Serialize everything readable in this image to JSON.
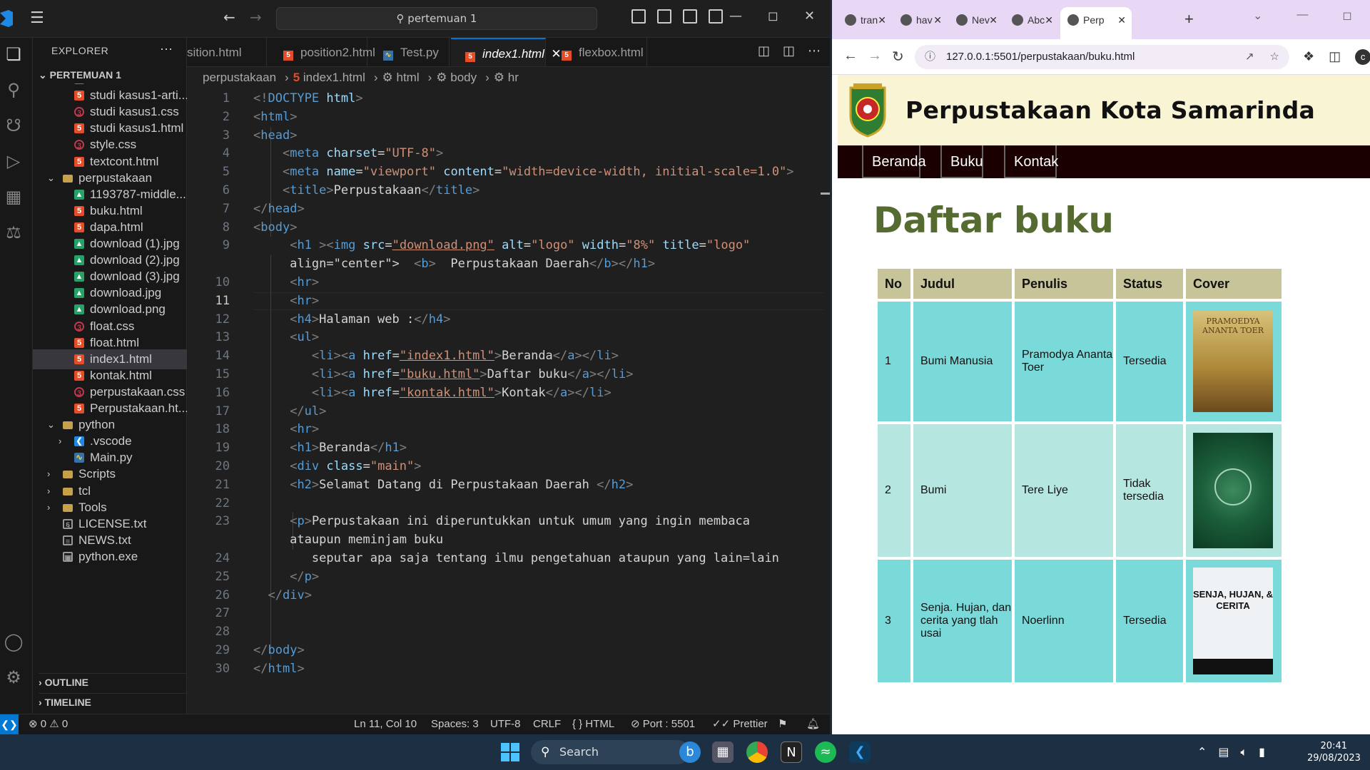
{
  "vscode": {
    "search_text": "pertemuan 1",
    "explorer_title": "EXPLORER",
    "workspace_root": "PERTEMUAN 1",
    "tree": [
      {
        "label": "studi kasus1-arti...",
        "icon": "html-file-icon",
        "depth": 2
      },
      {
        "label": "studi kasus1-arti...",
        "icon": "html-file-icon",
        "depth": 2
      },
      {
        "label": "studi kasus1.css",
        "icon": "css-file-icon",
        "depth": 2
      },
      {
        "label": "studi kasus1.html",
        "icon": "html-file-icon",
        "depth": 2
      },
      {
        "label": "style.css",
        "icon": "css-file-icon",
        "depth": 2
      },
      {
        "label": "textcont.html",
        "icon": "html-file-icon",
        "depth": 2
      },
      {
        "label": "perpustakaan",
        "icon": "folder-icon",
        "depth": 1,
        "expanded": true
      },
      {
        "label": "1193787-middle...",
        "icon": "image-file-icon",
        "depth": 2
      },
      {
        "label": "buku.html",
        "icon": "html-file-icon",
        "depth": 2
      },
      {
        "label": "dapa.html",
        "icon": "html-file-icon",
        "depth": 2
      },
      {
        "label": "download (1).jpg",
        "icon": "image-file-icon",
        "depth": 2
      },
      {
        "label": "download (2).jpg",
        "icon": "image-file-icon",
        "depth": 2
      },
      {
        "label": "download (3).jpg",
        "icon": "image-file-icon",
        "depth": 2
      },
      {
        "label": "download.jpg",
        "icon": "image-file-icon",
        "depth": 2
      },
      {
        "label": "download.png",
        "icon": "image-file-icon",
        "depth": 2
      },
      {
        "label": "float.css",
        "icon": "css-file-icon",
        "depth": 2
      },
      {
        "label": "float.html",
        "icon": "html-file-icon",
        "depth": 2
      },
      {
        "label": "index1.html",
        "icon": "html-file-icon",
        "depth": 2,
        "selected": true
      },
      {
        "label": "kontak.html",
        "icon": "html-file-icon",
        "depth": 2
      },
      {
        "label": "perpustakaan.css",
        "icon": "css-file-icon",
        "depth": 2
      },
      {
        "label": "Perpustakaan.ht...",
        "icon": "html-file-icon",
        "depth": 2
      },
      {
        "label": "python",
        "icon": "folder-icon",
        "depth": 1,
        "expanded": true
      },
      {
        "label": ".vscode",
        "icon": "vscode-folder-icon",
        "depth": 2,
        "expanded": false
      },
      {
        "label": "Main.py",
        "icon": "python-file-icon",
        "depth": 2
      },
      {
        "label": "Scripts",
        "icon": "folder-icon",
        "depth": 1,
        "expanded": false
      },
      {
        "label": "tcl",
        "icon": "folder-icon",
        "depth": 1,
        "expanded": false
      },
      {
        "label": "Tools",
        "icon": "folder-icon",
        "depth": 1,
        "expanded": false
      },
      {
        "label": "LICENSE.txt",
        "icon": "license-file-icon",
        "depth": 1
      },
      {
        "label": "NEWS.txt",
        "icon": "text-file-icon",
        "depth": 1
      },
      {
        "label": "python.exe",
        "icon": "exe-file-icon",
        "depth": 1
      }
    ],
    "outline_label": "OUTLINE",
    "timeline_label": "TIMELINE",
    "tabs": [
      {
        "label": "sition.html",
        "icon": "html-file-icon",
        "active": false
      },
      {
        "label": "position2.html",
        "icon": "html-file-icon",
        "active": false
      },
      {
        "label": "Test.py",
        "icon": "python-file-icon",
        "active": false
      },
      {
        "label": "index1.html",
        "icon": "html-file-icon",
        "active": true
      },
      {
        "label": "flexbox.html",
        "icon": "html-file-icon",
        "active": false
      }
    ],
    "breadcrumb": [
      "perpustakaan",
      "index1.html",
      "html",
      "body",
      "hr"
    ],
    "current_line": 11,
    "line_numbers": [
      "1",
      "2",
      "3",
      "4",
      "5",
      "6",
      "7",
      "8",
      "9",
      "",
      "10",
      "11",
      "12",
      "13",
      "14",
      "15",
      "16",
      "17",
      "18",
      "19",
      "20",
      "21",
      "22",
      "23",
      "",
      "24",
      "25",
      "26",
      "27",
      "28",
      "29",
      "30"
    ],
    "code_lines": [
      "<!DOCTYPE html>",
      "<html>",
      "<head>",
      "    <meta charset=\"UTF-8\">",
      "    <meta name=\"viewport\" content=\"width=device-width, initial-scale=1.0\">",
      "    <title>Perpustakaan</title>",
      "</head>",
      "<body>",
      "     <h1 ><img src=\"download.png\" alt=\"logo\" width=\"8%\" title=\"logo\"",
      "     align=\"center\">  <b>  Perpustakaan Daerah</b></h1>",
      "     <hr>",
      "     <hr>",
      "     <h4>Halaman web :</h4>",
      "     <ul>",
      "        <li><a href=\"index1.html\">Beranda</a></li>",
      "        <li><a href=\"buku.html\">Daftar buku</a></li>",
      "        <li><a href=\"kontak.html\">Kontak</a></li>",
      "     </ul>",
      "     <hr>",
      "     <h1>Beranda</h1>",
      "     <div class=\"main\">",
      "     <h2>Selamat Datang di Perpustakaan Daerah </h2>",
      "",
      "     <p>Perpustakaan ini diperuntukkan untuk umum yang ingin membaca",
      "     ataupun meminjam buku",
      "        seputar apa saja tentang ilmu pengetahuan ataupun yang lain=lain",
      "     </p>",
      "  </div>",
      "",
      "",
      "</body>",
      "</html>"
    ],
    "status": {
      "errors": "0",
      "warnings": "0",
      "position": "Ln 11, Col 10",
      "spaces": "Spaces: 3",
      "encoding": "UTF-8",
      "eol": "CRLF",
      "language": "HTML",
      "port": "Port : 5501",
      "prettier": "Prettier"
    }
  },
  "chrome": {
    "tabs": [
      {
        "label": "tran",
        "active": false
      },
      {
        "label": "hav",
        "active": false
      },
      {
        "label": "Nev",
        "active": false
      },
      {
        "label": "Abc",
        "active": false
      },
      {
        "label": "Perp",
        "active": true
      }
    ],
    "url": "127.0.0.1:5501/perpustakaan/buku.html",
    "profile_initial": "c"
  },
  "webpage": {
    "site_title": "Perpustakaan Kota Samarinda",
    "nav": [
      "Beranda",
      "Buku",
      "Kontak"
    ],
    "heading": "Daftar buku",
    "table": {
      "headers": [
        "No",
        "Judul",
        "Penulis",
        "Status",
        "Cover"
      ],
      "rows": [
        {
          "no": "1",
          "judul": "Bumi Manusia",
          "penulis": "Pramodya Ananta Toer",
          "status": "Tersedia",
          "cover_text": "PRAMOEDYA ANANTA TOER"
        },
        {
          "no": "2",
          "judul": "Bumi",
          "penulis": "Tere Liye",
          "status": "Tidak tersedia",
          "cover_text": ""
        },
        {
          "no": "3",
          "judul": "Senja. Hujan, dan cerita yang tlah usai",
          "penulis": "Noerlinn",
          "status": "Tersedia",
          "cover_text": "SENJA, HUJAN, & CERITA"
        }
      ]
    }
  },
  "taskbar": {
    "search_label": "Search",
    "time": "20:41",
    "date": "29/08/2023"
  }
}
